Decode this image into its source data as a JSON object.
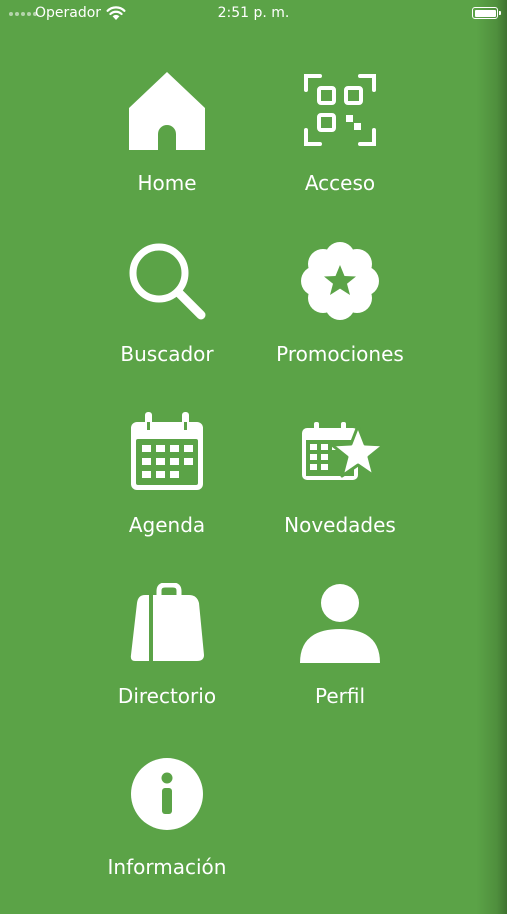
{
  "status_bar": {
    "carrier": "Operador",
    "time": "2:51 p. m."
  },
  "menu": {
    "items": [
      {
        "label": "Home",
        "icon": "home-icon"
      },
      {
        "label": "Acceso",
        "icon": "qr-code-icon"
      },
      {
        "label": "Buscador",
        "icon": "search-icon"
      },
      {
        "label": "Promociones",
        "icon": "star-badge-icon"
      },
      {
        "label": "Agenda",
        "icon": "calendar-icon"
      },
      {
        "label": "Novedades",
        "icon": "calendar-star-icon"
      },
      {
        "label": "Directorio",
        "icon": "shopping-bag-icon"
      },
      {
        "label": "Perfil",
        "icon": "user-icon"
      },
      {
        "label": "Información",
        "icon": "info-icon"
      }
    ]
  },
  "colors": {
    "background": "#5ba347",
    "foreground": "#ffffff"
  }
}
